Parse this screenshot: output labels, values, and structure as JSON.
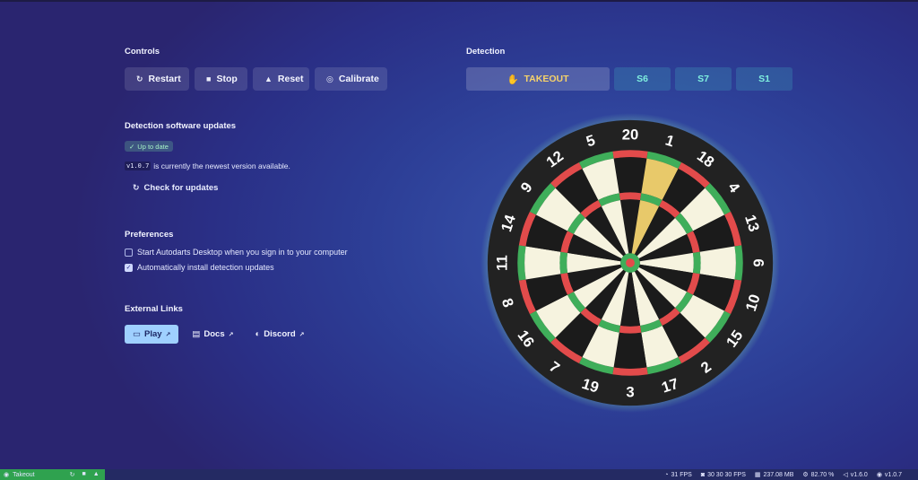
{
  "controls": {
    "heading": "Controls",
    "buttons": [
      {
        "label": "Restart",
        "icon": "restart-icon",
        "glyph": "↻"
      },
      {
        "label": "Stop",
        "icon": "stop-icon",
        "glyph": "■"
      },
      {
        "label": "Reset",
        "icon": "eject-icon",
        "glyph": "▲"
      },
      {
        "label": "Calibrate",
        "icon": "target-icon",
        "glyph": "◎"
      }
    ]
  },
  "detection": {
    "heading": "Detection",
    "takeout_label": "TAKEOUT",
    "takeout_icon": "hand-icon",
    "takeout_color": "#f6d36a",
    "throws": [
      "S6",
      "S7",
      "S1"
    ],
    "throw_color": "#7ff0df"
  },
  "updates": {
    "heading": "Detection software updates",
    "status_badge": "Up to date",
    "version": "v1.0.7",
    "version_text": "is currently the newest version available.",
    "check_label": "Check for updates"
  },
  "preferences": {
    "heading": "Preferences",
    "items": [
      {
        "label": "Start Autodarts Desktop when you sign in to your computer",
        "checked": false
      },
      {
        "label": "Automatically install detection updates",
        "checked": true
      }
    ]
  },
  "external_links": {
    "heading": "External Links",
    "links": [
      {
        "label": "Play",
        "icon": "gamepad-icon"
      },
      {
        "label": "Docs",
        "icon": "document-icon"
      },
      {
        "label": "Discord",
        "icon": "discord-icon"
      }
    ]
  },
  "board": {
    "numbers": [
      20,
      1,
      18,
      4,
      13,
      6,
      10,
      15,
      2,
      17,
      3,
      19,
      7,
      16,
      8,
      11,
      14,
      9,
      12,
      5
    ],
    "highlight_segment": 1,
    "colors": {
      "black": "#1b1b1b",
      "cream": "#f6f3df",
      "red": "#e24b4b",
      "green": "#3fae5a",
      "highlight": "#e8c96a",
      "rim": "#222222",
      "glow": "#8ff0b5"
    }
  },
  "statusbar": {
    "mode": "Takeout",
    "fps": "31 FPS",
    "camera_fps": "30 30 30 FPS",
    "memory": "237.08 MB",
    "cpu": "82.70 %",
    "app_version": "v1.6.0",
    "detect_version": "v1.0.7"
  }
}
